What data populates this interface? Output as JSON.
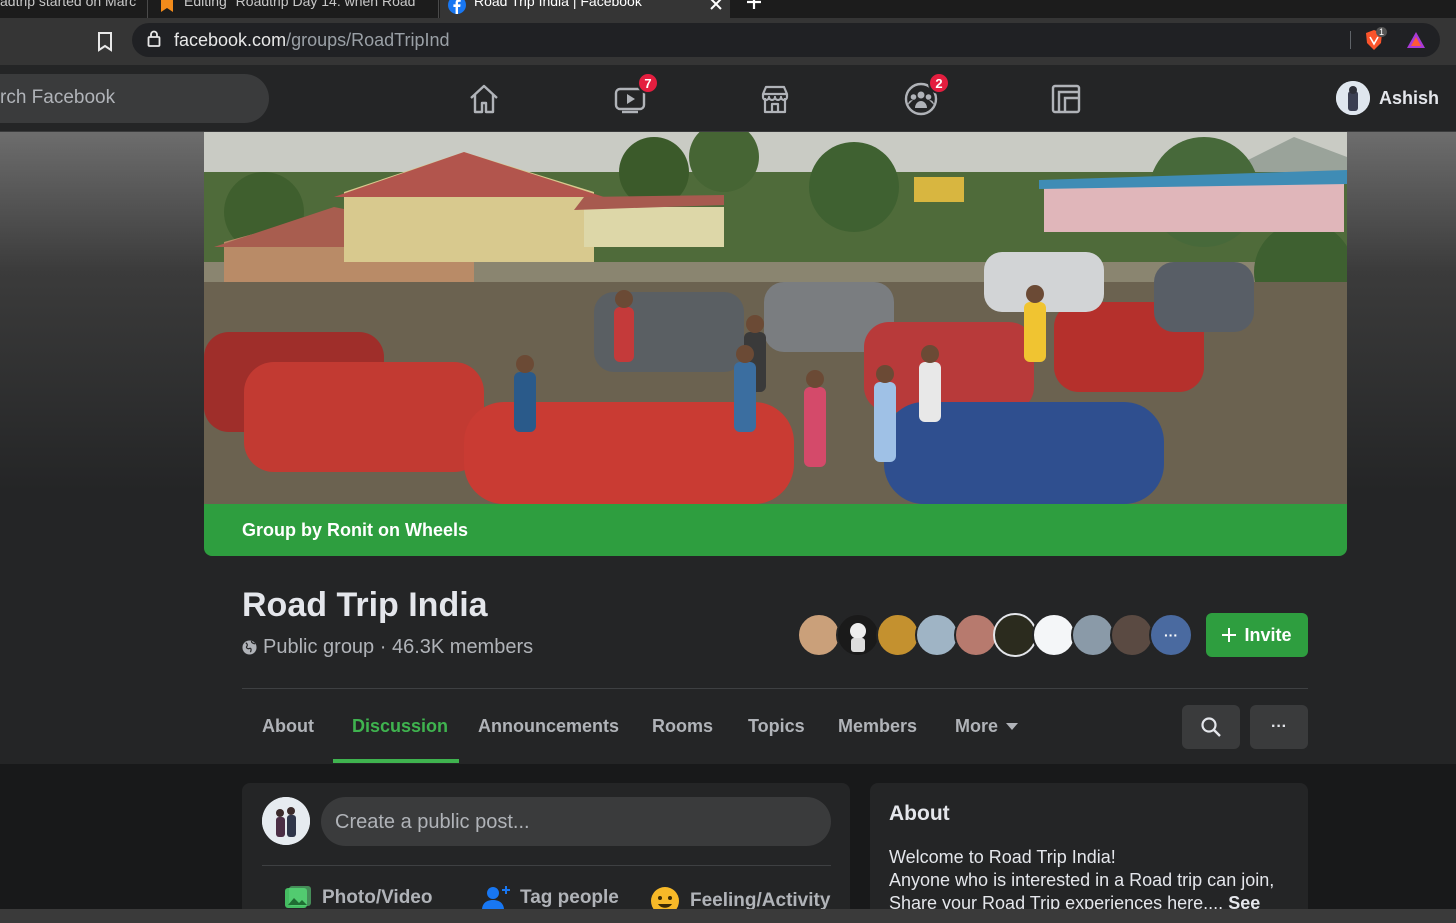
{
  "browser": {
    "tabs": [
      {
        "title": "adtrip started on Marc"
      },
      {
        "title": "Editing \"Roadtrip Day 14: when Road"
      },
      {
        "title": "Road Trip India | Facebook"
      }
    ],
    "new_tab_label": "+",
    "url_host": "facebook.com",
    "url_path": "/groups/RoadTripInd",
    "extension_badge": "1"
  },
  "fb_header": {
    "search_placeholder": "rch Facebook",
    "watch_badge": "7",
    "groups_badge": "2",
    "profile_name": "Ashish"
  },
  "group": {
    "banner_text": "Group by Ronit on Wheels",
    "title": "Road Trip India",
    "meta": "Public group · 46.3K members",
    "invite_label": "Invite",
    "more_members_icon": "···",
    "tabs": [
      {
        "label": "About"
      },
      {
        "label": "Discussion"
      },
      {
        "label": "Announcements"
      },
      {
        "label": "Rooms"
      },
      {
        "label": "Topics"
      },
      {
        "label": "Members"
      },
      {
        "label": "More"
      }
    ],
    "active_tab": "Discussion",
    "overflow_label": "···"
  },
  "composer": {
    "placeholder": "Create a public post...",
    "actions": [
      {
        "label": "Photo/Video",
        "icon": "photo-icon",
        "color": "#45bd62"
      },
      {
        "label": "Tag people",
        "icon": "tag-people-icon",
        "color": "#1877f2"
      },
      {
        "label": "Feeling/Activity",
        "icon": "feeling-icon",
        "color": "#f7b928"
      }
    ]
  },
  "about": {
    "title": "About",
    "line1": "Welcome to Road Trip India!",
    "line2": "Anyone who is interested in a Road trip can join,",
    "line3": "Share your Road Trip experiences here.... ",
    "see_more": "See"
  },
  "colors": {
    "accent_green": "#2e9e3f",
    "active_tab": "#3fb34f",
    "badge_red": "#e41e3f",
    "fb_surface": "#242526"
  }
}
